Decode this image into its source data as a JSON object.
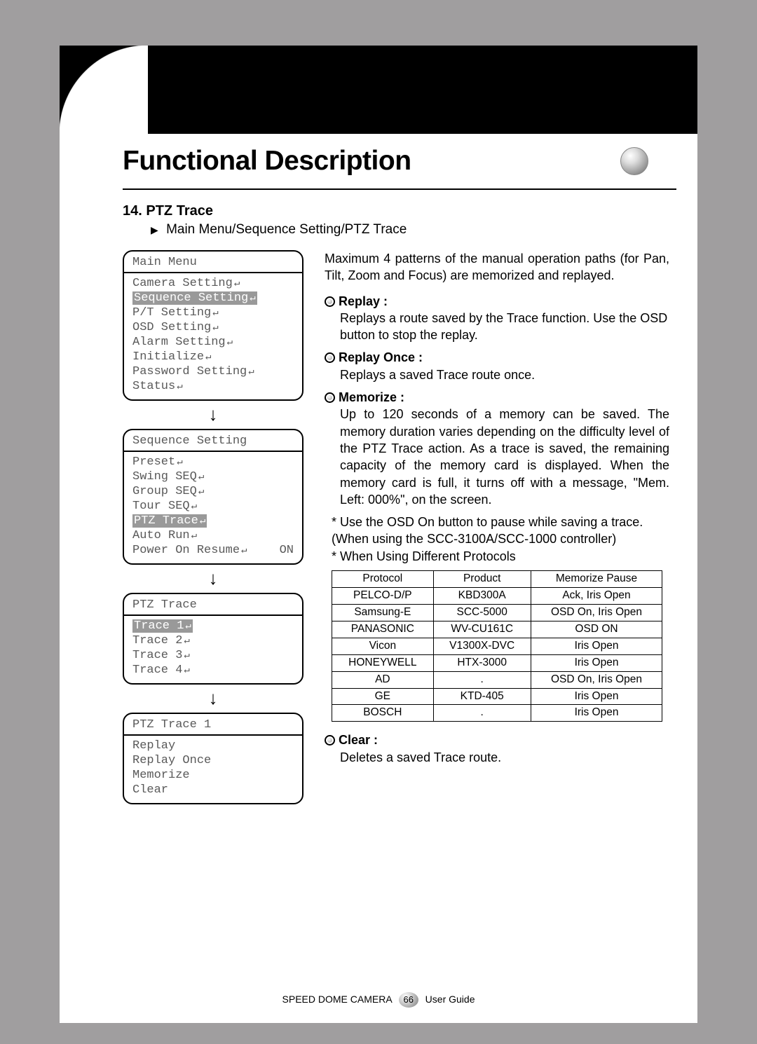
{
  "heading": "Functional Description",
  "section": {
    "number": "14.",
    "title": "PTZ Trace",
    "breadcrumb": "Main Menu/Sequence Setting/PTZ Trace"
  },
  "menus": {
    "main": {
      "title": "Main Menu",
      "items": [
        {
          "label": "Camera Setting",
          "sel": false
        },
        {
          "label": "Sequence Setting",
          "sel": true
        },
        {
          "label": "P/T Setting",
          "sel": false
        },
        {
          "label": "OSD Setting",
          "sel": false
        },
        {
          "label": "Alarm Setting",
          "sel": false
        },
        {
          "label": "Initialize",
          "sel": false
        },
        {
          "label": "Password Setting",
          "sel": false
        },
        {
          "label": "Status",
          "sel": false
        }
      ]
    },
    "seq": {
      "title": "Sequence Setting",
      "items": [
        {
          "label": "Preset",
          "sel": false,
          "val": ""
        },
        {
          "label": "Swing SEQ",
          "sel": false,
          "val": ""
        },
        {
          "label": "Group SEQ",
          "sel": false,
          "val": ""
        },
        {
          "label": "Tour SEQ",
          "sel": false,
          "val": ""
        },
        {
          "label": "PTZ Trace",
          "sel": true,
          "val": ""
        },
        {
          "label": "Auto Run",
          "sel": false,
          "val": ""
        },
        {
          "label": "Power On Resume",
          "sel": false,
          "val": "ON"
        }
      ]
    },
    "trace": {
      "title": "PTZ Trace",
      "items": [
        {
          "label": "Trace 1",
          "sel": true
        },
        {
          "label": "Trace 2",
          "sel": false
        },
        {
          "label": "Trace 3",
          "sel": false
        },
        {
          "label": "Trace 4",
          "sel": false
        }
      ]
    },
    "trace1": {
      "title": "PTZ Trace 1",
      "items": [
        {
          "label": "Replay"
        },
        {
          "label": "Replay Once"
        },
        {
          "label": "Memorize"
        },
        {
          "label": "Clear"
        }
      ]
    }
  },
  "intro": "Maximum 4 patterns of the manual operation paths (for Pan, Tilt, Zoom and Focus) are memorized and replayed.",
  "bullets": {
    "replay": {
      "head": "Replay :",
      "body": "Replays a route saved by the Trace function. Use the OSD button to stop the replay."
    },
    "replay_once": {
      "head": "Replay Once :",
      "body": "Replays a saved Trace route once."
    },
    "memorize": {
      "head": "Memorize :",
      "body": "Up to 120 seconds of a memory can be saved. The memory duration varies depending on the difficulty level of the PTZ Trace action.  As a trace is saved, the remaining capacity of the memory card is displayed. When the memory card is full, it turns off with a message, \"Mem. Left: 000%\", on the screen."
    },
    "clear": {
      "head": "Clear :",
      "body": "Deletes a saved Trace route."
    }
  },
  "notes": {
    "star1a": "* Use the OSD On button to pause while saving a trace.",
    "star1b": "  (When using the SCC-3100A/SCC-1000 controller)",
    "star2": "*  When Using Different Protocols"
  },
  "table": {
    "headers": [
      "Protocol",
      "Product",
      "Memorize Pause"
    ],
    "rows": [
      [
        "PELCO-D/P",
        "KBD300A",
        "Ack, Iris Open"
      ],
      [
        "Samsung-E",
        "SCC-5000",
        "OSD On, Iris Open"
      ],
      [
        "PANASONIC",
        "WV-CU161C",
        "OSD ON"
      ],
      [
        "Vicon",
        "V1300X-DVC",
        "Iris Open"
      ],
      [
        "HONEYWELL",
        "HTX-3000",
        "Iris Open"
      ],
      [
        "AD",
        ".",
        "OSD On, Iris Open"
      ],
      [
        "GE",
        "KTD-405",
        "Iris Open"
      ],
      [
        "BOSCH",
        ".",
        "Iris Open"
      ]
    ]
  },
  "footer": {
    "left": "SPEED DOME CAMERA",
    "page": "66",
    "right": "User Guide"
  }
}
